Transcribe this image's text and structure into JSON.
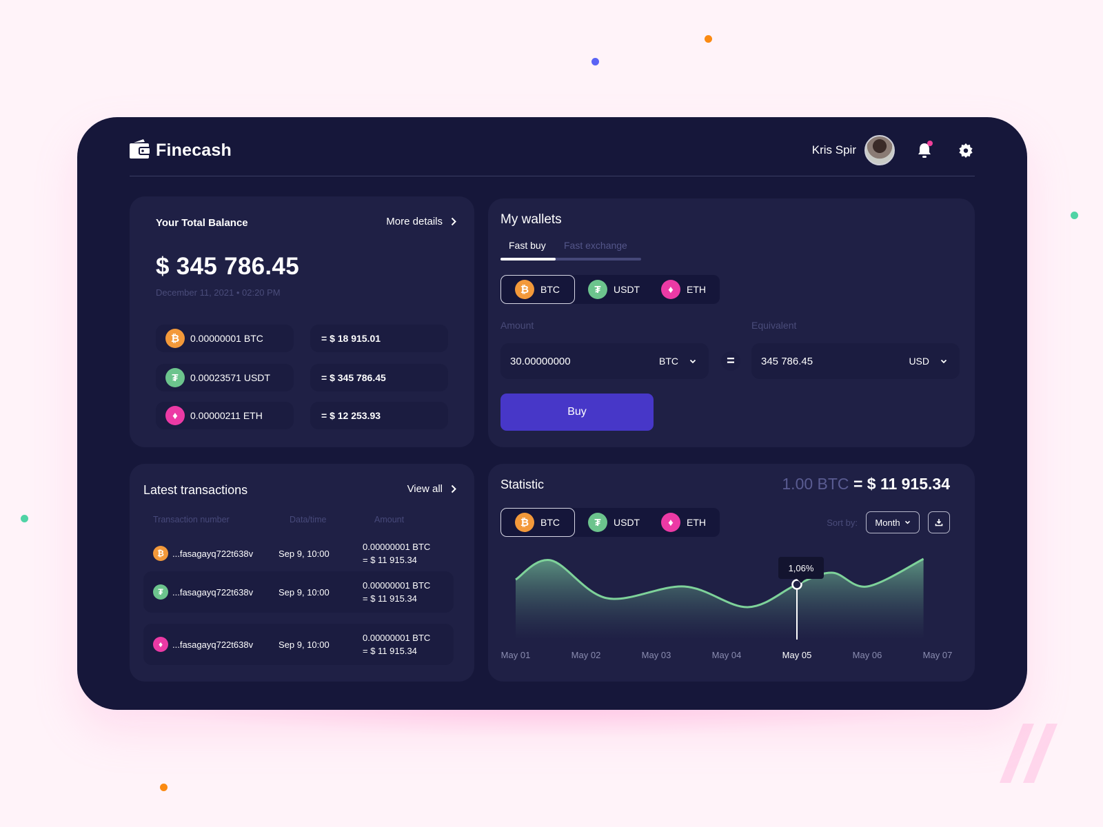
{
  "app": {
    "brand": "Finecash",
    "user_name": "Kris Spir",
    "colors": {
      "bg": "#fff3f9",
      "panel": "#16173a",
      "card": "#1f2045",
      "accent": "#4737c8",
      "btc": "#f3993a",
      "usdt": "#6cc48d",
      "eth": "#ec3aa5",
      "chart_line": "#7ed29a"
    }
  },
  "balance": {
    "title": "Your Total Balance",
    "more_label": "More details",
    "amount": "$ 345 786.45",
    "date": "December 11, 2021 • 02:20 PM",
    "assets": [
      {
        "coin": "btc",
        "glyph": "₿",
        "qty": "0.00000001 BTC",
        "value": "= $ 18 915.01"
      },
      {
        "coin": "usdt",
        "glyph": "₮",
        "qty": "0.00023571 USDT",
        "value": "= $ 345 786.45"
      },
      {
        "coin": "eth",
        "glyph": "♦",
        "qty": "0.00000211 ETH",
        "value": "= $ 12 253.93"
      }
    ]
  },
  "wallets": {
    "title": "My wallets",
    "tabs": [
      {
        "label": "Fast buy",
        "active": true
      },
      {
        "label": "Fast exchange",
        "active": false
      }
    ],
    "coins": [
      {
        "label": "BTC",
        "glyph": "₿",
        "active": true
      },
      {
        "label": "USDT",
        "glyph": "₮",
        "active": false
      },
      {
        "label": "ETH",
        "glyph": "♦",
        "active": false
      }
    ],
    "amount_label": "Amount",
    "amount_value": "30.00000000",
    "amount_unit": "BTC",
    "equals": "=",
    "equivalent_label": "Equivalent",
    "equivalent_value": "345 786.45",
    "equivalent_unit": "USD",
    "buy_label": "Buy"
  },
  "transactions": {
    "title": "Latest transactions",
    "view_all": "View all",
    "columns": [
      "Transaction number",
      "Data/time",
      "Amount"
    ],
    "rows": [
      {
        "coin": "btc",
        "glyph": "₿",
        "id": "...fasagayq722t638v",
        "date": "Sep 9, 10:00",
        "amount": "0.00000001 BTC",
        "usd": "= $ 11 915.34"
      },
      {
        "coin": "usdt",
        "glyph": "₮",
        "id": "...fasagayq722t638v",
        "date": "Sep 9, 10:00",
        "amount": "0.00000001 BTC",
        "usd": "= $ 11 915.34"
      },
      {
        "coin": "eth",
        "glyph": "♦",
        "id": "...fasagayq722t638v",
        "date": "Sep 9, 10:00",
        "amount": "0.00000001 BTC",
        "usd": "= $ 11 915.34"
      }
    ]
  },
  "statistic": {
    "title": "Statistic",
    "rate_left": "1.00 BTC",
    "rate_right": "= $ 11 915.34",
    "coins": [
      {
        "label": "BTC",
        "glyph": "₿",
        "active": true
      },
      {
        "label": "USDT",
        "glyph": "₮",
        "active": false
      },
      {
        "label": "ETH",
        "glyph": "♦",
        "active": false
      }
    ],
    "sort_label": "Sort by:",
    "sort_value": "Month"
  },
  "chart_data": {
    "type": "area",
    "title": "Statistic",
    "x": [
      "May 01",
      "May 02",
      "May 03",
      "May 04",
      "May 05",
      "May 06",
      "May 07"
    ],
    "series": [
      {
        "name": "BTC",
        "points": [
          [
            0.0,
            0.62
          ],
          [
            0.5,
            0.9
          ],
          [
            1.3,
            0.35
          ],
          [
            2.4,
            0.52
          ],
          [
            3.3,
            0.22
          ],
          [
            4.0,
            0.55
          ],
          [
            4.5,
            0.72
          ],
          [
            5.0,
            0.52
          ],
          [
            5.8,
            0.92
          ]
        ]
      }
    ],
    "highlight": {
      "x": "May 05",
      "label": "1,06%"
    },
    "active_x": "May 05",
    "grid": false,
    "yaxis_visible": false
  }
}
